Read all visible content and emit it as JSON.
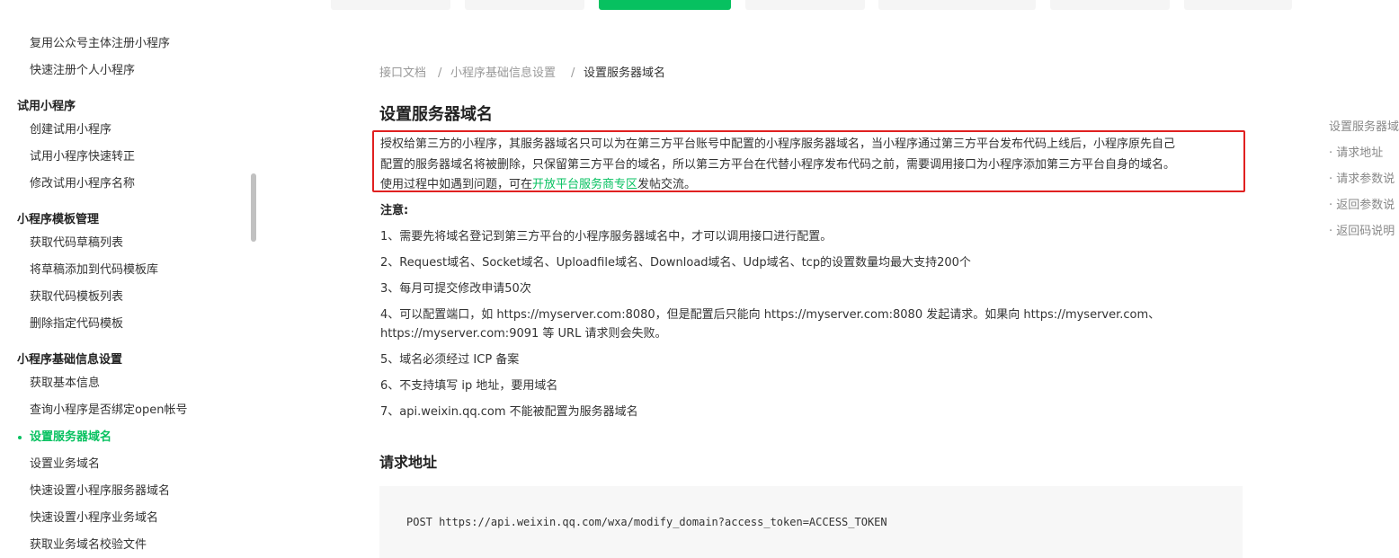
{
  "sidebar": {
    "items": [
      {
        "label": "复用公众号主体注册小程序"
      },
      {
        "label": "快速注册个人小程序"
      },
      {
        "label": "试用小程序",
        "group": true
      },
      {
        "label": "创建试用小程序"
      },
      {
        "label": "试用小程序快速转正"
      },
      {
        "label": "修改试用小程序名称"
      },
      {
        "label": "小程序模板管理",
        "group": true
      },
      {
        "label": "获取代码草稿列表"
      },
      {
        "label": "将草稿添加到代码模板库"
      },
      {
        "label": "获取代码模板列表"
      },
      {
        "label": "删除指定代码模板"
      },
      {
        "label": "小程序基础信息设置",
        "group": true
      },
      {
        "label": "获取基本信息"
      },
      {
        "label": "查询小程序是否绑定open帐号"
      },
      {
        "label": "设置服务器域名",
        "active": true
      },
      {
        "label": "设置业务域名"
      },
      {
        "label": "快速设置小程序服务器域名"
      },
      {
        "label": "快速设置小程序业务域名"
      },
      {
        "label": "获取业务域名校验文件"
      }
    ]
  },
  "breadcrumb": {
    "items": [
      "接口文档",
      "小程序基础信息设置",
      "设置服务器域名"
    ],
    "separator": "/"
  },
  "main": {
    "title": "设置服务器域名",
    "intro_line1": "授权给第三方的小程序，其服务器域名只可以为在第三方平台账号中配置的小程序服务器域名，当小程序通过第三方平台发布代码上线后，小程序原先自己",
    "intro_line2": "配置的服务器域名将被删除，只保留第三方平台的域名，所以第三方平台在代替小程序发布代码之前，需要调用接口为小程序添加第三方平台自身的域名。",
    "intro_line3_prefix": "使用过程中如遇到问题，可在",
    "intro_line3_link": "开放平台服务商专区",
    "intro_line3_suffix": "发帖交流。",
    "note_title": "注意:",
    "notes": [
      "1、需要先将域名登记到第三方平台的小程序服务器域名中，才可以调用接口进行配置。",
      "2、Request域名、Socket域名、Uploadfile域名、Download域名、Udp域名、tcp的设置数量均最大支持200个",
      "3、每月可提交修改申请50次",
      "4、可以配置端口，如 https://myserver.com:8080，但是配置后只能向 https://myserver.com:8080 发起请求。如果向 https://myserver.com、",
      "https://myserver.com:9091 等 URL 请求则会失败。",
      "5、域名必须经过 ICP 备案",
      "6、不支持填写 ip 地址，要用域名",
      "7、api.weixin.qq.com 不能被配置为服务器域名"
    ],
    "request_section_title": "请求地址",
    "request_code": "POST https://api.weixin.qq.com/wxa/modify_domain?access_token=ACCESS_TOKEN"
  },
  "toc": {
    "items": [
      "设置服务器域",
      "· 请求地址",
      "· 请求参数说",
      "· 返回参数说",
      "· 返回码说明"
    ]
  },
  "colors": {
    "accent": "#07c160",
    "highlight_border": "#e02020"
  }
}
